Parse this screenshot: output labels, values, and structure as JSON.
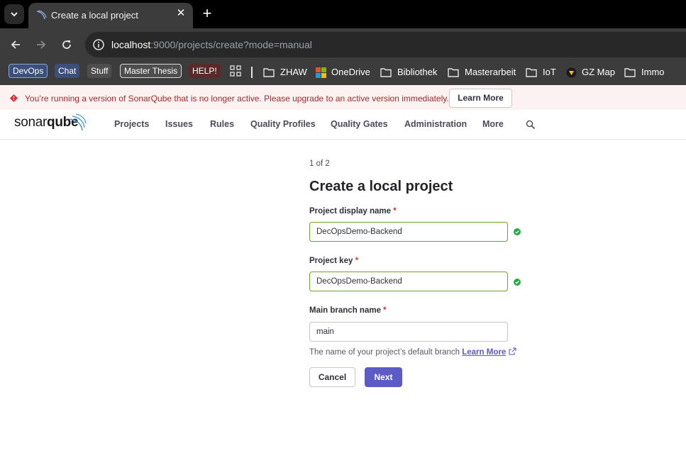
{
  "browser": {
    "tab": {
      "title": "Create a local project"
    },
    "url": {
      "host": "localhost",
      "rest": ":9000/projects/create?mode=manual"
    },
    "bookmarks": {
      "chips": [
        {
          "label": "DevOps",
          "color": "#3b4f7a"
        },
        {
          "label": "Chat",
          "color": "#3b4f7a"
        },
        {
          "label": "Stuff",
          "color": "#4e4e4e"
        },
        {
          "label": "Master Thesis",
          "color": "#4e4e4e"
        },
        {
          "label": "HELP!",
          "color": "#5a2a2a"
        }
      ],
      "folders": [
        "ZHAW",
        "OneDrive",
        "Bibliothek",
        "Masterarbeit",
        "IoT",
        "GZ Map",
        "Immo"
      ]
    }
  },
  "banner": {
    "text": "You’re running a version of SonarQube that is no longer active. Please upgrade to an active version immediately.",
    "button": "Learn More"
  },
  "nav": {
    "logo_regular": "sonar",
    "logo_bold": "qube",
    "items": [
      "Projects",
      "Issues",
      "Rules",
      "Quality Profiles",
      "Quality Gates",
      "Administration",
      "More"
    ]
  },
  "form": {
    "step": "1 of 2",
    "title": "Create a local project",
    "required_mark": "*",
    "display_name": {
      "label": "Project display name",
      "value": "DecOpsDemo-Backend"
    },
    "project_key": {
      "label": "Project key",
      "value": "DecOpsDemo-Backend"
    },
    "main_branch": {
      "label": "Main branch name",
      "value": "main"
    },
    "help_text": "The name of your project’s default branch",
    "help_link": "Learn More",
    "cancel": "Cancel",
    "next": "Next"
  },
  "colors": {
    "accent": "#5d5bc8",
    "valid": "#28a745",
    "warning": "#d02f3a"
  }
}
